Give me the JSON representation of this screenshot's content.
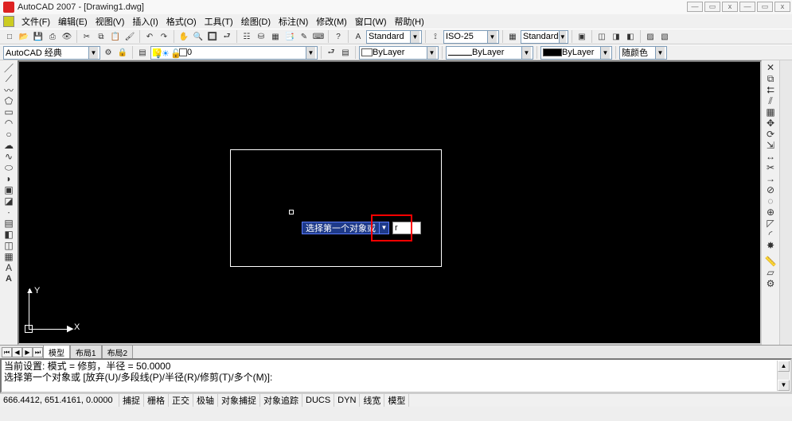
{
  "title": {
    "app": "AutoCAD 2007",
    "doc": "[Drawing1.dwg]"
  },
  "win_btns": {
    "min": "—",
    "max": "▭",
    "close": "x",
    "min2": "—",
    "max2": "▭",
    "close2": "x"
  },
  "menus": {
    "file": "文件(F)",
    "edit": "编辑(E)",
    "view": "视图(V)",
    "insert": "插入(I)",
    "format": "格式(O)",
    "tools": "工具(T)",
    "draw": "绘图(D)",
    "dimension": "标注(N)",
    "modify": "修改(M)",
    "window": "窗口(W)",
    "help": "帮助(H)"
  },
  "workspace": {
    "current": "AutoCAD 经典"
  },
  "layer": {
    "current": "0"
  },
  "text_style": {
    "current": "Standard"
  },
  "dim_style": {
    "current": "ISO-25"
  },
  "table_style": {
    "current": "Standard"
  },
  "color_ctrl": {
    "current": "ByLayer"
  },
  "linetype_ctrl": {
    "current": "ByLayer"
  },
  "lineweight_ctrl": {
    "current": "ByLayer",
    "swatch": "#000000"
  },
  "plotcolor": {
    "current": "随颜色"
  },
  "dynamic_input": {
    "prompt": "选择第一个对象或",
    "value": "r"
  },
  "ucs": {
    "x": "X",
    "y": "Y"
  },
  "tabs": {
    "model": "模型",
    "layout1": "布局1",
    "layout2": "布局2"
  },
  "cmd": {
    "line1": "当前设置: 模式 = 修剪，半径 = 50.0000",
    "line2": "选择第一个对象或 [放弃(U)/多段线(P)/半径(R)/修剪(T)/多个(M)]:"
  },
  "status": {
    "coords": "666.4412, 651.4161, 0.0000",
    "snap": "捕捉",
    "grid": "栅格",
    "ortho": "正交",
    "polar": "极轴",
    "osnap": "对象捕捉",
    "otrack": "对象追踪",
    "ducs": "DUCS",
    "dyn": "DYN",
    "lwt": "线宽",
    "model": "模型"
  },
  "icons": {
    "new": "□",
    "open": "📂",
    "save": "💾",
    "plot": "⎙",
    "preview": "👁",
    "cut": "✂",
    "copy": "⧉",
    "paste": "📋",
    "match": "🖌",
    "undo": "↶",
    "redo": "↷",
    "pan": "✋",
    "zoom_rt": "🔍",
    "zoom_w": "🔲",
    "zoom_p": "⮐",
    "props": "☷",
    "dc": "⛁",
    "tp": "▦",
    "sheet": "📑",
    "markup": "✎",
    "calc": "⌨",
    "help": "?",
    "line": "／",
    "cline": "⟋",
    "pline": "〰",
    "poly": "⬠",
    "rect": "▭",
    "arc": "◠",
    "circle": "○",
    "revcl": "☁",
    "spline": "∿",
    "ellipse": "⬭",
    "ellarc": "◗",
    "block": "▣",
    "point": "∙",
    "hatch": "▤",
    "grad": "◧",
    "region": "◫",
    "table": "▦",
    "text": "A",
    "erase": "✕",
    "copy_m": "⧉",
    "mirror": "⮄",
    "offset": "⫽",
    "array": "▦",
    "move": "✥",
    "rotate": "⟳",
    "scale": "⇲",
    "stretch": "↔",
    "trim": "✂",
    "extend": "→",
    "break_pt": "⊘",
    "break": "◌",
    "join": "⊕",
    "chamfer": "◸",
    "fillet": "◜",
    "explode": "✸",
    "dist": "📏",
    "area": "▱",
    "massprop": "⚙"
  }
}
